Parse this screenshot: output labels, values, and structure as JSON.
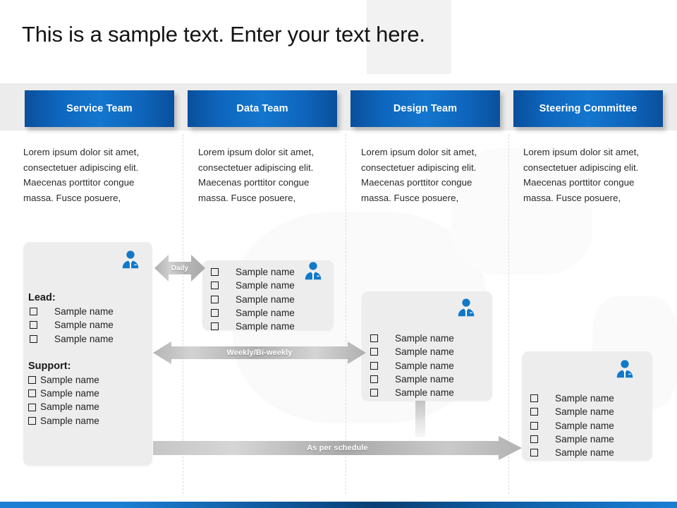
{
  "slide": {
    "title": "This is a sample text. Enter your text here.",
    "background_color": "#ffffff",
    "band_color": "#ECECEC",
    "accent_blue": "#1476CF",
    "card_color": "#EDEDED",
    "arrow_color": "#B4B4B4",
    "footer_color": "#0D4F8F"
  },
  "tabs": [
    {
      "label": "Service Team"
    },
    {
      "label": "Data Team"
    },
    {
      "label": "Design Team"
    },
    {
      "label": "Steering Committee"
    }
  ],
  "paragraphs": [
    {
      "text": "Lorem ipsum dolor sit amet, consectetuer adipiscing elit. Maecenas porttitor congue massa. Fusce posuere,"
    },
    {
      "text": "Lorem ipsum dolor sit amet, consectetuer adipiscing elit. Maecenas porttitor congue massa. Fusce posuere,"
    },
    {
      "text": "Lorem ipsum dolor sit amet, consectetuer adipiscing elit. Maecenas porttitor congue massa. Fusce posuere,"
    },
    {
      "text": "Lorem ipsum dolor sit amet, consectetuer adipiscing elit. Maecenas porttitor congue massa. Fusce posuere,"
    }
  ],
  "cards": [
    {
      "icon": "businessperson-icon",
      "groups": [
        {
          "heading": "Lead:",
          "items": [
            "Sample name",
            "Sample name",
            "Sample name"
          ]
        },
        {
          "heading": "Support:",
          "items": [
            "Sample name",
            "Sample name",
            "Sample name",
            "Sample name"
          ]
        }
      ]
    },
    {
      "icon": "businessperson-icon",
      "groups": [
        {
          "heading": "",
          "items": [
            "Sample name",
            "Sample name",
            "Sample name",
            "Sample name",
            "Sample name"
          ]
        }
      ]
    },
    {
      "icon": "businessperson-icon",
      "groups": [
        {
          "heading": "",
          "items": [
            "Sample name",
            "Sample name",
            "Sample name",
            "Sample name",
            "Sample name"
          ]
        }
      ]
    },
    {
      "icon": "businessperson-icon",
      "groups": [
        {
          "heading": "",
          "items": [
            "Sample name",
            "Sample name",
            "Sample name",
            "Sample name",
            "Sample name"
          ]
        }
      ]
    }
  ],
  "arrows": {
    "daily": {
      "label": "Daily",
      "direction": "both"
    },
    "weekly": {
      "label": "Weekly/Bi-weekly",
      "direction": "both"
    },
    "schedule": {
      "label": "As per schedule",
      "direction": "right"
    }
  }
}
